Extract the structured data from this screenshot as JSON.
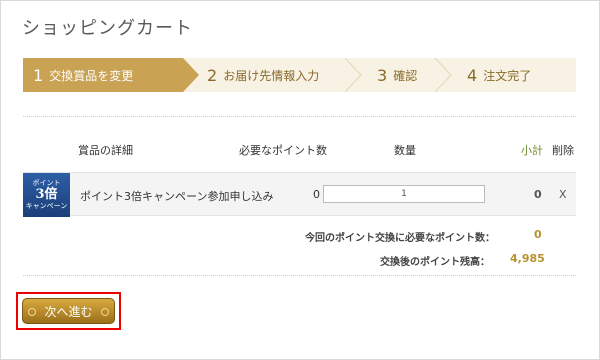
{
  "page": {
    "title": "ショッピングカート"
  },
  "steps": [
    {
      "num": "1",
      "label": "交換賞品を変更",
      "active": true
    },
    {
      "num": "2",
      "label": "お届け先情報入力",
      "active": false
    },
    {
      "num": "3",
      "label": "確認",
      "active": false
    },
    {
      "num": "4",
      "label": "注文完了",
      "active": false
    }
  ],
  "table": {
    "headers": {
      "details": "賞品の詳細",
      "points": "必要なポイント数",
      "quantity": "数量",
      "subtotal": "小計",
      "delete": "削除"
    },
    "rows": [
      {
        "thumbnail_text": [
          "ポイント",
          "3倍",
          "キャンペーン"
        ],
        "name": "ポイント3倍キャンペーン参加申し込み",
        "points": "0",
        "quantity": "1",
        "subtotal": "0",
        "delete": "X"
      }
    ]
  },
  "summary": {
    "required_label": "今回のポイント交換に必要なポイント数：",
    "required_value": "0",
    "balance_label": "交換後のポイント残高：",
    "balance_value": "4,985"
  },
  "next_button": {
    "label": "次へ進む"
  },
  "colors": {
    "active_step": "#c9a253",
    "inactive_step": "#f7f2e3",
    "highlight_box": "#e00000",
    "subtotal_header": "#6a8d2a",
    "value_gold": "#b8922e"
  }
}
